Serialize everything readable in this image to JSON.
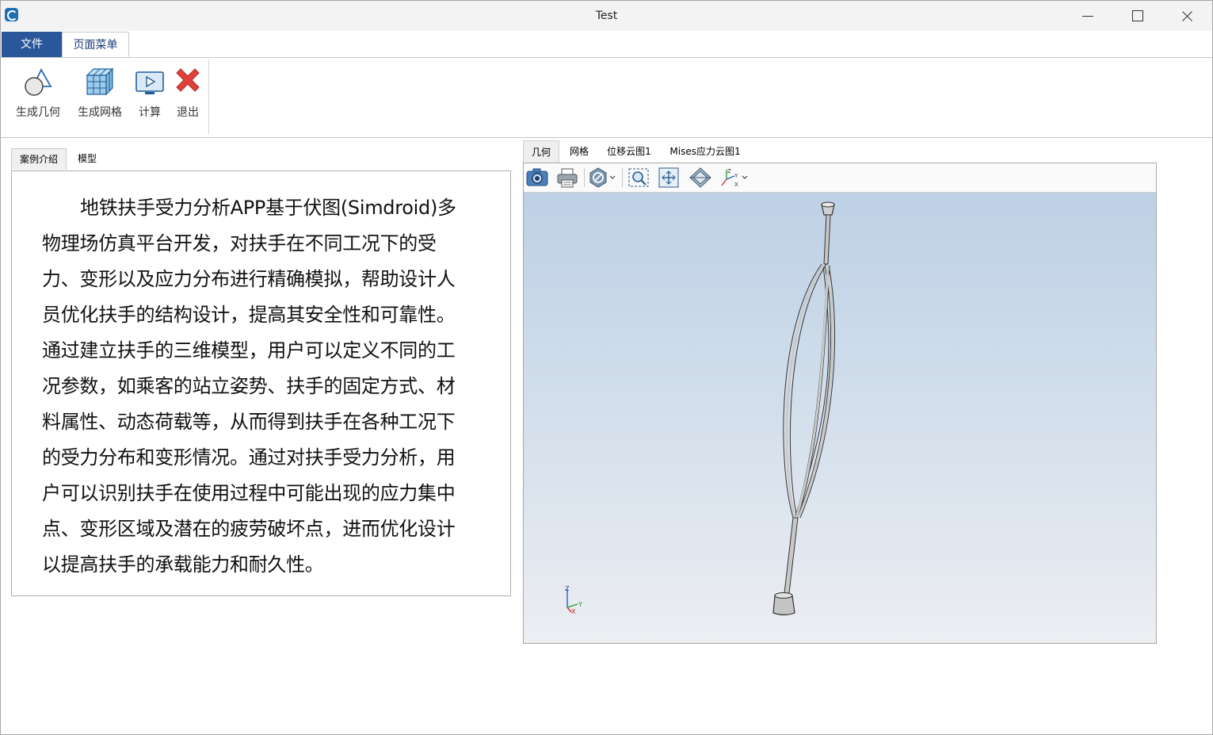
{
  "window": {
    "title": "Test"
  },
  "ribbon": {
    "tabs": [
      {
        "label": "文件"
      },
      {
        "label": "页面菜单"
      }
    ],
    "buttons": [
      {
        "label": "生成几何",
        "icon": "geometry-icon"
      },
      {
        "label": "生成网格",
        "icon": "mesh-icon"
      },
      {
        "label": "计算",
        "icon": "compute-icon"
      },
      {
        "label": "退出",
        "icon": "exit-icon"
      }
    ]
  },
  "left": {
    "tabs": [
      {
        "label": "案例介绍"
      },
      {
        "label": "模型"
      }
    ],
    "intro": "地铁扶手受力分析APP基于伏图(Simdroid)多物理场仿真平台开发，对扶手在不同工况下的受力、变形以及应力分布进行精确模拟，帮助设计人员优化扶手的结构设计，提高其安全性和可靠性。通过建立扶手的三维模型，用户可以定义不同的工况参数，如乘客的站立姿势、扶手的固定方式、材料属性、动态荷载等，从而得到扶手在各种工况下的受力分布和变形情况。通过对扶手受力分析，用户可以识别扶手在使用过程中可能出现的应力集中点、变形区域及潜在的疲劳破坏点，进而优化设计以提高扶手的承载能力和耐久性。"
  },
  "viewer": {
    "tabs": [
      {
        "label": "几何"
      },
      {
        "label": "网格"
      },
      {
        "label": "位移云图1"
      },
      {
        "label": "Mises应力云图1"
      }
    ],
    "toolbar": [
      "camera-icon",
      "print-icon",
      "display-mode-icon",
      "zoom-box-icon",
      "fit-view-icon",
      "view-cube-icon",
      "axis-view-icon"
    ],
    "axes": {
      "z": "Z",
      "y": "Y",
      "x": "X"
    },
    "colors": {
      "background_top": "#bdd0e5",
      "background_bottom": "#eceef2",
      "model": "#c9c9c9"
    }
  },
  "colors": {
    "file_tab": "#2a569a",
    "accent": "#1c3f7a"
  }
}
